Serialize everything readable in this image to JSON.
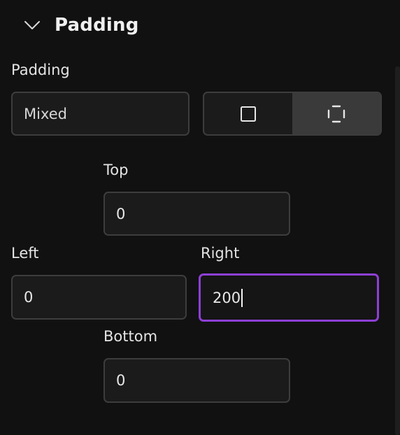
{
  "section": {
    "title": "Padding",
    "icon": "chevron-down-icon"
  },
  "padding": {
    "label": "Padding",
    "mode_value": "Mixed",
    "toggle": {
      "uniform_icon": "square-icon",
      "individual_icon": "padding-sides-icon",
      "active": "individual"
    }
  },
  "sides": {
    "top": {
      "label": "Top",
      "value": "0"
    },
    "left": {
      "label": "Left",
      "value": "0"
    },
    "right": {
      "label": "Right",
      "value": "200"
    },
    "bottom": {
      "label": "Bottom",
      "value": "0"
    }
  },
  "colors": {
    "background": "#111111",
    "field_background": "#1b1b1b",
    "field_border": "#3d3d3d",
    "focus_border": "#8e3fd6",
    "active_toggle": "#3a3a3a"
  }
}
